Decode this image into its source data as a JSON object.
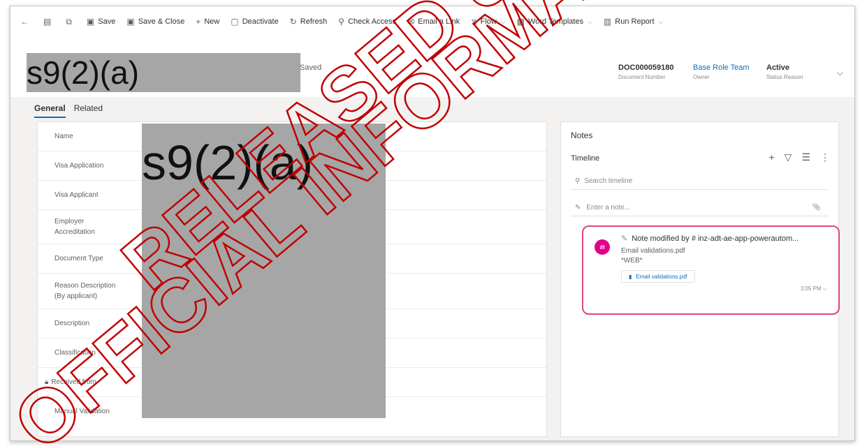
{
  "command_bar": {
    "items": [
      {
        "icon": "back-arrow-icon",
        "label": ""
      },
      {
        "icon": "form-icon",
        "label": ""
      },
      {
        "icon": "open-new-window-icon",
        "label": ""
      },
      {
        "icon": "save-icon",
        "label": "Save"
      },
      {
        "icon": "save-close-icon",
        "label": "Save & Close"
      },
      {
        "icon": "plus-icon",
        "label": "New"
      },
      {
        "icon": "deactivate-icon",
        "label": "Deactivate"
      },
      {
        "icon": "refresh-icon",
        "label": "Refresh"
      },
      {
        "icon": "check-access-icon",
        "label": "Check Access"
      },
      {
        "icon": "email-link-icon",
        "label": "Email a Link"
      },
      {
        "icon": "flow-icon",
        "label": "Flow"
      },
      {
        "icon": "word-templates-icon",
        "label": "Word Templates"
      },
      {
        "icon": "run-report-icon",
        "label": "Run Report"
      }
    ]
  },
  "header": {
    "save_status": "Saved",
    "fields": [
      {
        "value": "DOC000059180",
        "label": "Document Number"
      },
      {
        "value": "Base Role Team",
        "label": "Owner"
      },
      {
        "value": "Active",
        "label": "Status Reason"
      }
    ]
  },
  "tabs": [
    "General",
    "Related"
  ],
  "form": {
    "fields": [
      {
        "label": "Name"
      },
      {
        "label": "Visa Application"
      },
      {
        "label": "Visa Applicant"
      },
      {
        "label": "Employer Accreditation"
      },
      {
        "label": "Document Type"
      },
      {
        "label": "Reason Description (By applicant)"
      },
      {
        "label": "Description"
      },
      {
        "label": "Classification"
      },
      {
        "label": "Received from",
        "locked": true
      },
      {
        "label": "Manual Validation"
      }
    ]
  },
  "notes": {
    "title": "Notes",
    "timeline_title": "Timeline",
    "search_placeholder": "Search timeline",
    "note_placeholder": "Enter a note...",
    "entry": {
      "avatar_initials": "#I",
      "heading": "Note modified by # inz-adt-ae-app-powerautom...",
      "line1": "Email validations.pdf",
      "line2": "*WEB*",
      "attachment": "Email validations.pdf",
      "time": "3:05 PM"
    }
  },
  "redactions": {
    "code1": "s9(2)(a)",
    "code2": "s9(2)(a)"
  },
  "watermark": {
    "line1": "RELEASED UNDER THE",
    "line2": "OFFICIAL INFORMATION"
  }
}
